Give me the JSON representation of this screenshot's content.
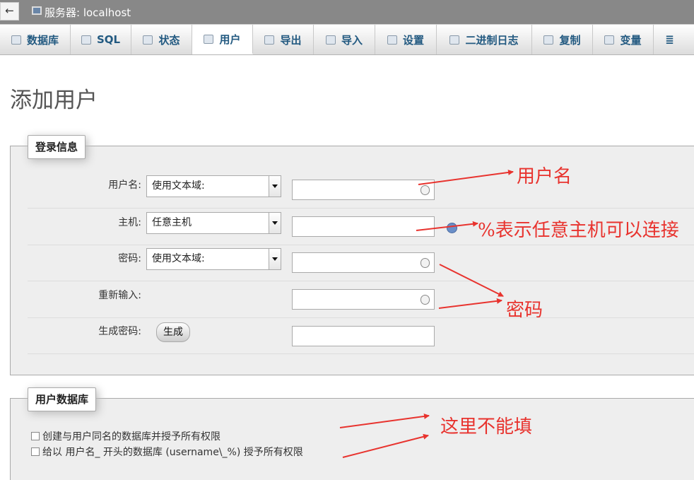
{
  "window": {
    "back_label": "←",
    "server_title": "服务器: localhost"
  },
  "tabs": [
    {
      "label": "数据库",
      "icon": "database-icon"
    },
    {
      "label": "SQL",
      "icon": "sql-icon"
    },
    {
      "label": "状态",
      "icon": "status-icon"
    },
    {
      "label": "用户",
      "icon": "users-icon",
      "active": true
    },
    {
      "label": "导出",
      "icon": "export-icon"
    },
    {
      "label": "导入",
      "icon": "import-icon"
    },
    {
      "label": "设置",
      "icon": "wrench-icon"
    },
    {
      "label": "二进制日志",
      "icon": "binlog-icon"
    },
    {
      "label": "复制",
      "icon": "replication-icon"
    },
    {
      "label": "变量",
      "icon": "variables-icon"
    },
    {
      "label": "≣",
      "icon": "more-menu-icon"
    }
  ],
  "page": {
    "title": "添加用户"
  },
  "login": {
    "legend": "登录信息",
    "username_label": "用户名:",
    "username_select": "使用文本域:",
    "host_label": "主机:",
    "host_select": "任意主机",
    "password_label": "密码:",
    "password_select": "使用文本域:",
    "reenter_label": "重新输入:",
    "generate_label": "生成密码:",
    "generate_button": "生成"
  },
  "userdb": {
    "legend": "用户数据库",
    "option1": "创建与用户同名的数据库并授予所有权限",
    "option2": "给以 用户名_ 开头的数据库 (username\\_%) 授予所有权限"
  },
  "annotations": {
    "username_note": "用户名",
    "host_note": "%表示任意主机可以连接",
    "password_note": "密码",
    "db_note": "这里不能填"
  },
  "colors": {
    "annotation": "#e8332e",
    "tab_text": "#235a81",
    "topbar": "#888888"
  }
}
